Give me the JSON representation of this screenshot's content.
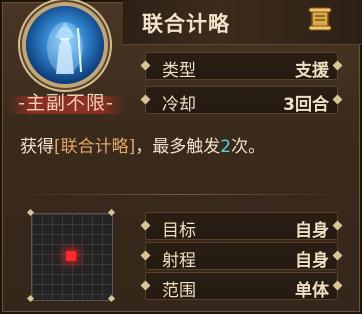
{
  "skill": {
    "name": "联合计略",
    "restriction": "-主副不限-"
  },
  "attributes": [
    {
      "key": "类型",
      "value": "支援"
    },
    {
      "key": "冷却",
      "value": "3回合"
    }
  ],
  "description": {
    "prefix": "获得",
    "highlight": "[联合计略]",
    "middle": "，最多触发",
    "count": "2",
    "suffix": "次。"
  },
  "range_info": [
    {
      "key": "目标",
      "value": "自身"
    },
    {
      "key": "射程",
      "value": "自身"
    },
    {
      "key": "范围",
      "value": "单体"
    }
  ],
  "icons": {
    "portrait": "mage-portrait-icon",
    "scroll": "scroll-icon"
  },
  "colors": {
    "highlight": "#e5a66b",
    "number": "#5fcfe0",
    "target_cell": "#ff2a2a"
  }
}
